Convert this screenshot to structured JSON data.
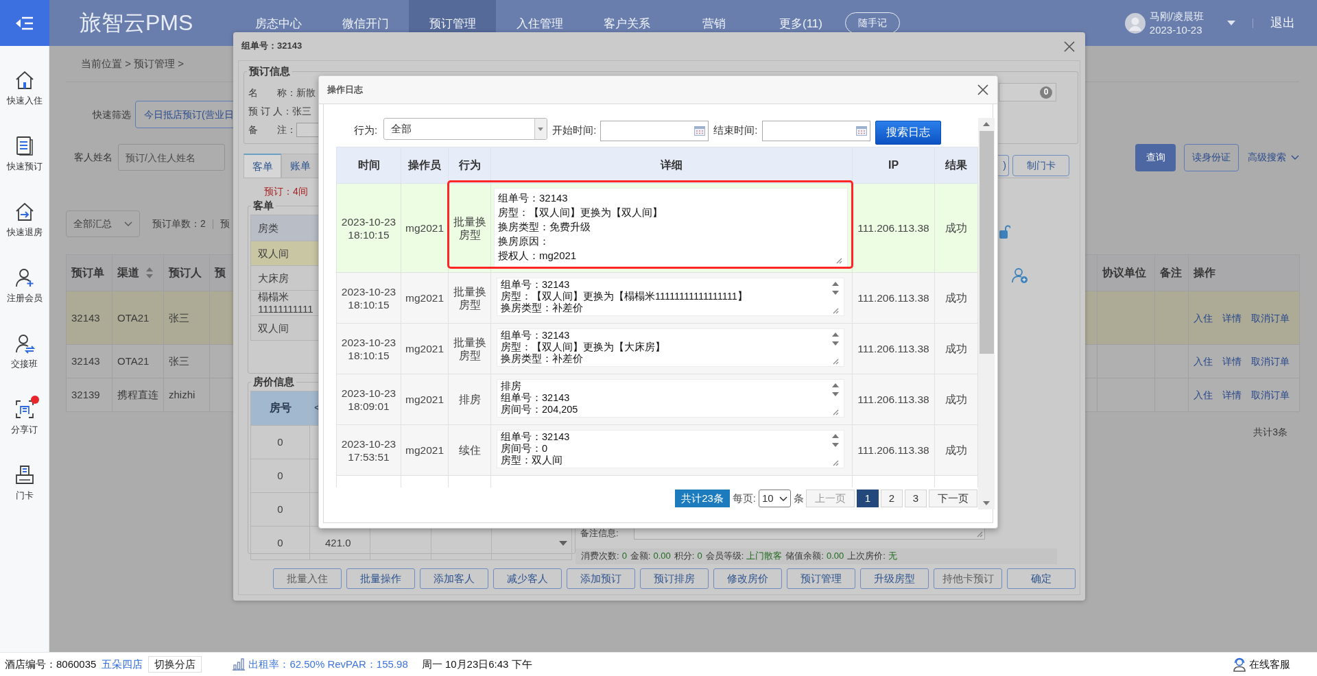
{
  "topbar": {
    "logo": "旅智云PMS",
    "nav": [
      {
        "label": "房态中心",
        "selected": false
      },
      {
        "label": "微信开门",
        "selected": false
      },
      {
        "label": "预订管理",
        "selected": true
      },
      {
        "label": "入住管理",
        "selected": false
      },
      {
        "label": "客户关系",
        "selected": false
      },
      {
        "label": "营销",
        "selected": false
      },
      {
        "label": "更多(11)",
        "selected": false
      }
    ],
    "note_button": "随手记",
    "user": {
      "name": "马刚/凌晨班",
      "date": "2023-10-23"
    },
    "logout": "退出"
  },
  "sidebar": {
    "items": [
      {
        "label": "快速入住",
        "dot": false
      },
      {
        "label": "快速预订",
        "dot": false
      },
      {
        "label": "快速退房",
        "dot": false
      },
      {
        "label": "注册会员",
        "dot": false
      },
      {
        "label": "交接班",
        "dot": false
      },
      {
        "label": "分享订",
        "dot": true
      },
      {
        "label": "门卡",
        "dot": false
      }
    ]
  },
  "page": {
    "breadcrumb": "当前位置 > 预订管理 >",
    "quick_filter": {
      "label": "快速筛选",
      "button": "今日抵店预订(营业日"
    },
    "guest_name": {
      "label": "客人姓名",
      "placeholder": "预订/入住人姓名"
    },
    "search_button": "查询",
    "id_card_button": "读身份证",
    "advanced_search": "高级搜索",
    "summary_select": "全部汇总",
    "stats": [
      "预订单数：2",
      "预"
    ],
    "orders": {
      "columns": [
        {
          "label": "预订单",
          "sortable": false
        },
        {
          "label": "渠道",
          "sortable": true
        },
        {
          "label": "预订人",
          "sortable": false
        },
        {
          "label": "预",
          "sortable": false
        },
        {
          "label": "协议单位",
          "sortable": false
        },
        {
          "label": "备注",
          "sortable": false
        },
        {
          "label": "操作",
          "sortable": false
        }
      ],
      "rows": [
        {
          "cells": [
            "32143",
            "OTA21",
            "张三"
          ],
          "selected": true,
          "actions": [
            "入住",
            "详情",
            "取消订单"
          ]
        },
        {
          "cells": [
            "32143",
            "OTA21",
            "张三"
          ],
          "selected": false,
          "actions": [
            "入住",
            "详情",
            "取消订单"
          ]
        },
        {
          "cells": [
            "32139",
            "携程直连",
            "zhizhi"
          ],
          "selected": false,
          "actions": [
            "入住",
            "详情",
            "取消订单"
          ]
        }
      ],
      "total": "共计3条"
    }
  },
  "group_dialog": {
    "title": "组单号：32143",
    "booking_info": {
      "legend": "预订信息",
      "fields": [
        {
          "label": "名　　称：",
          "value": "新散",
          "kind": "text"
        },
        {
          "label": "预 订 人：",
          "value": "张三",
          "kind": "text"
        },
        {
          "label": "备　　注：",
          "kind": "input"
        }
      ],
      "counter": "0"
    },
    "tabs": [
      {
        "label": "客单",
        "selected": true
      },
      {
        "label": "账单",
        "selected": false
      }
    ],
    "tab_buttons": [
      ")",
      "制门卡"
    ],
    "room_count": "预订：4间",
    "guest_list": {
      "legend": "客单",
      "header": "房类",
      "rows": [
        {
          "lines": [
            "双人间"
          ],
          "selected": true
        },
        {
          "lines": [
            "大床房"
          ],
          "selected": false
        },
        {
          "lines": [
            "榻榻米",
            "11111111111"
          ],
          "selected": false
        },
        {
          "lines": [
            "双人间"
          ],
          "selected": false
        }
      ]
    },
    "price_info": {
      "legend": "房价信息",
      "columns": [
        "房号",
        "<"
      ],
      "rows": [
        {
          "room": "0"
        },
        {
          "room": "0"
        },
        {
          "room": "0"
        },
        {
          "room": "0",
          "price": "421.0"
        }
      ]
    },
    "remarks_label": "备注信息:",
    "member_stats": [
      {
        "label": "消费次数:",
        "value": "0"
      },
      {
        "label": "金额:",
        "value": "0.00"
      },
      {
        "label": "积分:",
        "value": "0"
      },
      {
        "label": "会员等级:",
        "value": "上门散客"
      },
      {
        "label": "储值余额:",
        "value": "0.00"
      },
      {
        "label": "上次房价:",
        "value": "无"
      }
    ],
    "actions": [
      {
        "label": "批量入住",
        "disabled": true
      },
      {
        "label": "批量操作",
        "disabled": false
      },
      {
        "label": "添加客人",
        "disabled": false
      },
      {
        "label": "减少客人",
        "disabled": false
      },
      {
        "label": "添加预订",
        "disabled": false
      },
      {
        "label": "预订排房",
        "disabled": false
      },
      {
        "label": "修改房价",
        "disabled": false
      },
      {
        "label": "预订管理",
        "disabled": false
      },
      {
        "label": "升级房型",
        "disabled": false
      },
      {
        "label": "持他卡预订",
        "disabled": true
      },
      {
        "label": "确定",
        "disabled": false
      }
    ]
  },
  "log_dialog": {
    "title": "操作日志",
    "filters": {
      "action": {
        "label": "行为:",
        "value": "全部"
      },
      "start": {
        "label": "开始时间:"
      },
      "end": {
        "label": "结束时间:"
      },
      "search_button": "搜索日志"
    },
    "columns": [
      "时间",
      "操作员",
      "行为",
      "详细",
      "IP",
      "结果"
    ],
    "rows": [
      {
        "time": "2023-10-23 18:10:15",
        "operator": "mg2021",
        "action": "批量换房型",
        "detail": [
          "组单号：32143",
          "房型：【双人间】更换为【双人间】",
          "换房类型：免费升级",
          "换房原因：",
          "授权人：mg2021"
        ],
        "ip": "111.206.113.38",
        "result": "成功",
        "selected": true,
        "expanded": true,
        "highlighted": true
      },
      {
        "time": "2023-10-23 18:10:15",
        "operator": "mg2021",
        "action": "批量换房型",
        "detail": [
          "组单号：32143",
          "房型：【双人间】更换为【榻榻米11111111111111111】",
          "换房类型：补差价"
        ],
        "ip": "111.206.113.38",
        "result": "成功",
        "selected": false,
        "expanded": false,
        "highlighted": false
      },
      {
        "time": "2023-10-23 18:10:15",
        "operator": "mg2021",
        "action": "批量换房型",
        "detail": [
          "组单号：32143",
          "房型：【双人间】更换为【大床房】",
          "换房类型：补差价"
        ],
        "ip": "111.206.113.38",
        "result": "成功",
        "selected": false,
        "expanded": false,
        "highlighted": false
      },
      {
        "time": "2023-10-23 18:09:01",
        "operator": "mg2021",
        "action": "排房",
        "detail": [
          "排房",
          "组单号：32143",
          "房间号：204,205"
        ],
        "ip": "111.206.113.38",
        "result": "成功",
        "selected": false,
        "expanded": false,
        "highlighted": false
      },
      {
        "time": "2023-10-23 17:53:51",
        "operator": "mg2021",
        "action": "续住",
        "detail": [
          "组单号：32143",
          "房间号：0",
          "房型：双人间"
        ],
        "ip": "111.206.113.38",
        "result": "成功",
        "selected": false,
        "expanded": false,
        "highlighted": false
      }
    ],
    "pagination": {
      "total": "共计23条",
      "per_page_label": "每页:",
      "per_page": "10",
      "unit": "条",
      "prev": {
        "label": "上一页",
        "disabled": true
      },
      "pages": [
        {
          "label": "1",
          "selected": true
        },
        {
          "label": "2",
          "selected": false
        },
        {
          "label": "3",
          "selected": false
        }
      ],
      "next": {
        "label": "下一页",
        "disabled": false
      }
    }
  },
  "status_bar": {
    "hotel_id": "酒店编号：8060035",
    "hotel_name": "五朵四店",
    "switch_button": "切换分店",
    "occupancy": "出租率：62.50% RevPAR：155.98",
    "datetime": "周一 10月23日6:43 下午",
    "support": "在线客服"
  }
}
